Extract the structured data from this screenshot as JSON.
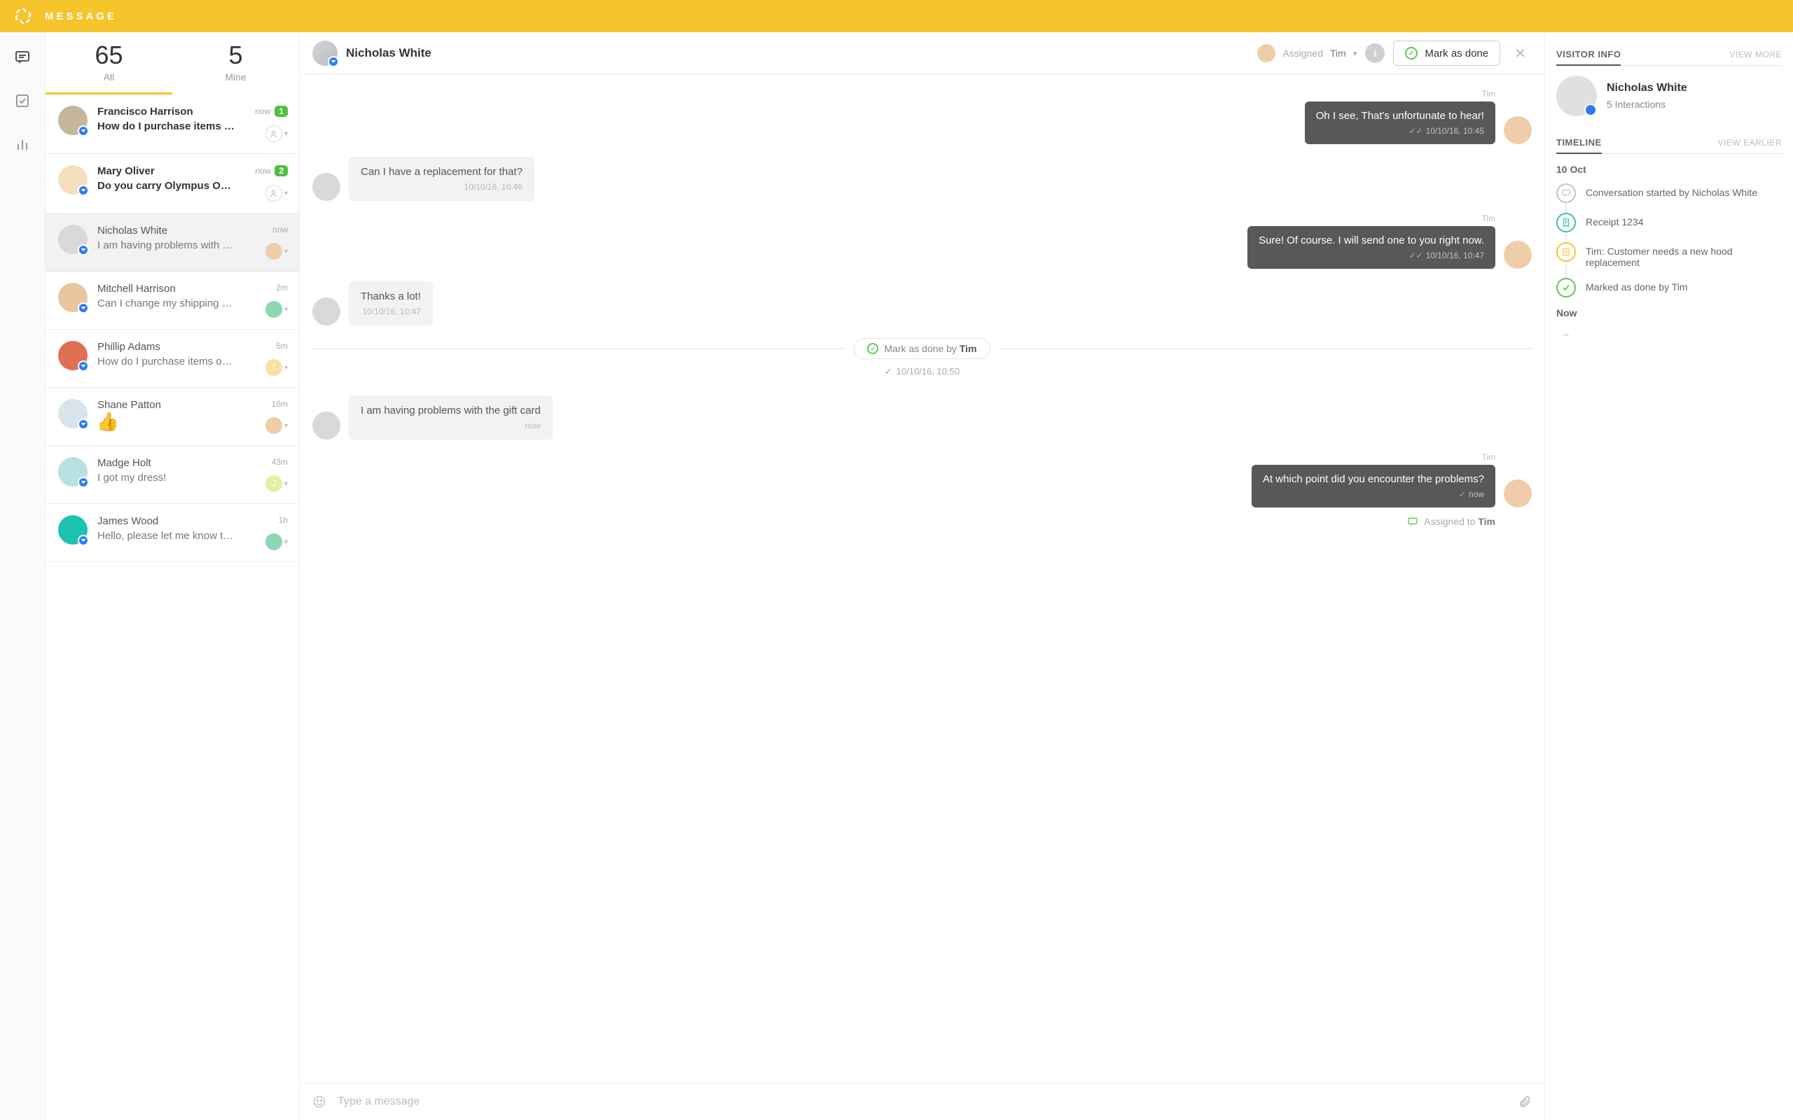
{
  "header": {
    "title": "MESSAGE"
  },
  "tabs": {
    "all": {
      "count": "65",
      "label": "All"
    },
    "mine": {
      "count": "5",
      "label": "Mine"
    }
  },
  "conversations": [
    {
      "name": "Francisco Harrison",
      "preview": "How do I purchase items o…",
      "time": "now",
      "unread": "1",
      "bold": true,
      "assignee": "–"
    },
    {
      "name": "Mary Oliver",
      "preview": "Do you carry Olympus OM…",
      "time": "now",
      "unread": "2",
      "bold": true,
      "assignee": "–"
    },
    {
      "name": "Nicholas White",
      "preview": "I am having problems with …",
      "time": "now",
      "unread": "",
      "bold": false,
      "assignee": "tim",
      "selected": true
    },
    {
      "name": "Mitchell Harrison",
      "preview": "Can I change my shipping a…",
      "time": "2m",
      "unread": "",
      "bold": false,
      "assignee": "ag-green"
    },
    {
      "name": "Phillip Adams",
      "preview": "How do I purchase items onlin…",
      "time": "5m",
      "unread": "",
      "bold": false,
      "assignee": "T"
    },
    {
      "name": "Shane Patton",
      "preview": "__thumb__",
      "time": "16m",
      "unread": "",
      "bold": false,
      "assignee": "tim"
    },
    {
      "name": "Madge Holt",
      "preview": "I got my dress!",
      "time": "43m",
      "unread": "",
      "bold": false,
      "assignee": "J"
    },
    {
      "name": "James Wood",
      "preview": "Hello, please let me know t…",
      "time": "1h",
      "unread": "",
      "bold": false,
      "assignee": "ag-green"
    }
  ],
  "chat": {
    "contact": "Nicholas White",
    "assigned_label": "Assigned",
    "assigned_to": "Tim",
    "done_button": "Mark as done",
    "done_sep_prefix": "Mark as done by",
    "done_sep_name": "Tim",
    "done_sep_time": "10/10/16, 10:50",
    "assigned_note_prefix": "Assigned to",
    "assigned_note_name": "Tim",
    "messages": [
      {
        "side": "right",
        "author": "Tim",
        "text": "Oh I see, That's unfortunate to hear!",
        "meta": "10/10/16, 10:45",
        "checks": true
      },
      {
        "side": "left",
        "author": "",
        "text": "Can I have a replacement for that?",
        "meta": "10/10/16, 10:46"
      },
      {
        "side": "right",
        "author": "Tim",
        "text": "Sure! Of course. I will send one to you right now.",
        "meta": "10/10/16, 10:47",
        "checks": true
      },
      {
        "side": "left",
        "author": "",
        "text": "Thanks a lot!",
        "meta": "10/10/16, 10:47"
      },
      {
        "side": "sep"
      },
      {
        "side": "left",
        "author": "",
        "text": "I am having problems with the gift card",
        "meta": "now"
      },
      {
        "side": "right",
        "author": "Tim",
        "text": "At which point did you encounter the problems?",
        "meta": "now",
        "single_check": true
      }
    ],
    "composer_placeholder": "Type a message"
  },
  "info": {
    "visitor_title": "VISITOR INFO",
    "view_more": "VIEW MORE",
    "name": "Nicholas White",
    "interactions": "5 Interactions",
    "timeline_title": "TIMELINE",
    "view_earlier": "VIEW EARLIER",
    "date": "10 Oct",
    "items": [
      {
        "color": "#BFC6CC",
        "text": "Conversation started by Nicholas White",
        "icon": "chat"
      },
      {
        "color": "#3AC1AE",
        "text": "Receipt 1234",
        "icon": "receipt"
      },
      {
        "color": "#F6C52B",
        "text": "Tim: Customer needs a new hood replacement",
        "icon": "note"
      },
      {
        "color": "#61C555",
        "text": "Marked as done by Tim",
        "icon": "check"
      }
    ],
    "now_label": "Now",
    "dash": "–"
  }
}
